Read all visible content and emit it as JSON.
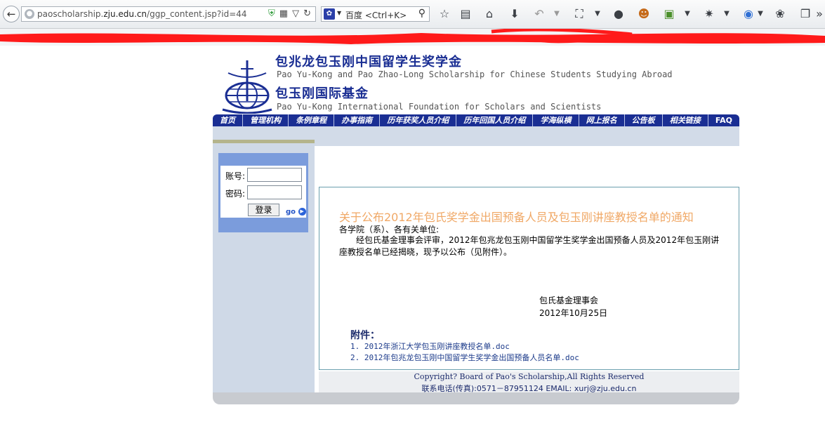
{
  "browser": {
    "url_host": "paoscholarship.",
    "url_domain": "zju.edu.cn",
    "url_path": "/ggp_content.jsp?id=44",
    "search_placeholder": "百度 <Ctrl+K>",
    "search_engine_icon": "baidu-paw-icon"
  },
  "header": {
    "title_cn_1": "包兆龙包玉刚中国留学生奖学金",
    "title_en_1": "Pao Yu-Kong and Pao Zhao-Long Scholarship for Chinese Students Studying Abroad",
    "title_cn_2": "包玉刚国际基金",
    "title_en_2": "Pao Yu-Kong International Foundation for Scholars and Scientists",
    "logo_icon": "anchor-globe-logo-icon",
    "brand_color": "#1a2e93"
  },
  "nav": [
    "首页",
    "管理机构",
    "条例章程",
    "办事指南",
    "历年获奖人员介绍",
    "历年回国人员介绍",
    "学海纵横",
    "网上报名",
    "公告板",
    "相关链接",
    "FAQ"
  ],
  "login": {
    "account_label": "账号:",
    "password_label": "密码:",
    "account_value": "",
    "password_value": "",
    "button_label": "登录",
    "go_label": "go"
  },
  "notice": {
    "title": "关于公布2012年包氏奖学金出国预备人员及包玉刚讲座教授名单的通知",
    "salutation": "各学院（系）、各有关单位:",
    "body": "经包氏基金理事会评审，2012年包兆龙包玉刚中国留学生奖学金出国预备人员及2012年包玉刚讲座教授名单已经揭晓，现予以公布（见附件）。",
    "sign_org": "包氏基金理事会",
    "sign_date": "2012年10月25日",
    "attachments_title": "附件：",
    "attachments": [
      "1. 2012年浙江大学包玉刚讲座教授名单.doc",
      "2. 2012年包兆龙包玉刚中国留学生奖学金出国预备人员名单.doc"
    ],
    "title_color": "#f0a866"
  },
  "footer": {
    "copyright": "Copyright? Board of Pao's Scholarship,All Rights Reserved",
    "contact": "联系电话(传真):0571－87951124    EMAIL: xurj@zju.edu.cn"
  }
}
